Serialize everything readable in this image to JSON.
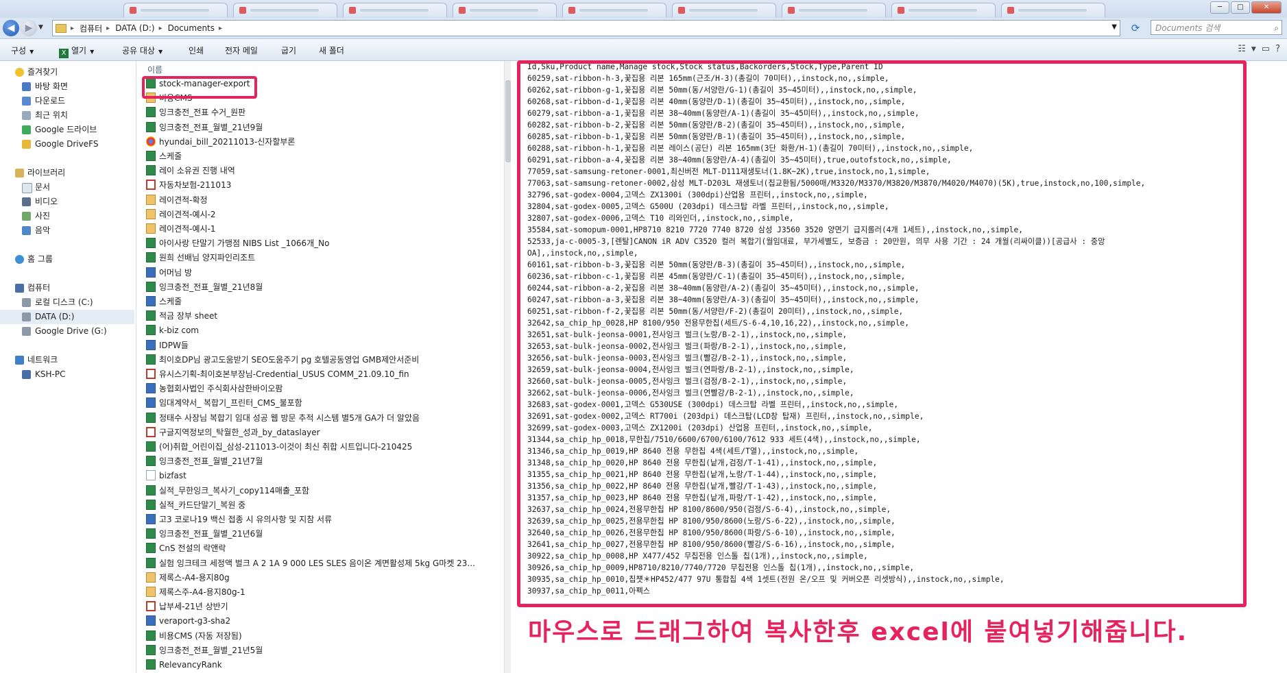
{
  "address": {
    "crumbs": [
      "컴퓨터",
      "DATA (D:)",
      "Documents"
    ],
    "search_placeholder": "Documents 검색"
  },
  "toolbar": {
    "organize": "구성",
    "open": "열기",
    "share": "공유 대상",
    "print": "인쇄",
    "email": "전자 메일",
    "burn": "굽기",
    "new_folder": "새 폴더"
  },
  "nav": {
    "favorites": "즐겨찾기",
    "desktop": "바탕 화면",
    "downloads": "다운로드",
    "recent": "최근 위치",
    "gdrive": "Google 드라이브",
    "gdrivefs": "Google DriveFS",
    "libraries": "라이브러리",
    "documents": "문서",
    "videos": "비디오",
    "pictures": "사진",
    "music": "음악",
    "homegroup": "홈 그룹",
    "computer": "컴퓨터",
    "local_c": "로컬 디스크 (C:)",
    "data_d": "DATA (D:)",
    "gdrive_g": "Google Drive (G:)",
    "network": "네트워크",
    "pc": "KSH-PC"
  },
  "file_list": {
    "column_name": "이름",
    "files": [
      {
        "name": "stock-manager-export",
        "icon": "excel-icon"
      },
      {
        "name": "비용CMS",
        "icon": "zip-icon"
      },
      {
        "name": "잉크충전_전표 수거_원판",
        "icon": "excel-icon"
      },
      {
        "name": "잉크충전_전표_월별_21년9월",
        "icon": "excel-icon"
      },
      {
        "name": "hyundai_bill_20211013-신자할부론",
        "icon": "chrome-icon"
      },
      {
        "name": "스케줄",
        "icon": "excel-icon"
      },
      {
        "name": "레이 소유권 진행 내역",
        "icon": "excel-icon"
      },
      {
        "name": "자동차보험-211013",
        "icon": "pdf-icon"
      },
      {
        "name": "레이견적-확정",
        "icon": "zip-icon"
      },
      {
        "name": "레이견적-예시-2",
        "icon": "zip-icon"
      },
      {
        "name": "레이견적-예시-1",
        "icon": "zip-icon"
      },
      {
        "name": "아이사랑 단말기 가맹점 NIBS List _1066개_No",
        "icon": "excel-icon"
      },
      {
        "name": "원희 선배님 양지파인리조트",
        "icon": "excel-icon"
      },
      {
        "name": "어머님 방",
        "icon": "hwp-icon"
      },
      {
        "name": "잉크충전_전표_월별_21년8월",
        "icon": "excel-icon"
      },
      {
        "name": "스케줄",
        "icon": "hwp-icon"
      },
      {
        "name": "적금 장부 sheet",
        "icon": "excel-icon"
      },
      {
        "name": "k-biz com",
        "icon": "excel-icon"
      },
      {
        "name": "IDPW들",
        "icon": "hwp-icon"
      },
      {
        "name": "최이호DP님 광고도움받기 SEO도움주기 pg 호텔공동영업 GMB제안서준비",
        "icon": "excel-icon"
      },
      {
        "name": "유시스기획-최이호본부장님-Credential_USUS COMM_21.09.10_fin",
        "icon": "pdf-icon"
      },
      {
        "name": "농협회사법인 주식회사삼한바이오팜",
        "icon": "hwp-icon"
      },
      {
        "name": "임대계약서_ 복합기_프린터_CMS_불포함",
        "icon": "hwp-icon"
      },
      {
        "name": "정태수 사장님    복합기 임대 성공    웹 방문 추적 시스템 별5개     GA가 더 알았음",
        "icon": "excel-icon"
      },
      {
        "name": "구글지역정보의_탁월한_성과_by_dataslayer",
        "icon": "pdf-icon"
      },
      {
        "name": "(어)취합_어린이집_삼성-211013-이것이 최신 취합 시트입니다-210425",
        "icon": "excel-icon"
      },
      {
        "name": "잉크충전_전표_월별_21년7월",
        "icon": "excel-icon"
      },
      {
        "name": "bizfast",
        "icon": "text-icon"
      },
      {
        "name": "실적_무한잉크_복사기_copy114매출_포함",
        "icon": "excel-icon"
      },
      {
        "name": "실적_카드단말기_복원 중",
        "icon": "excel-icon"
      },
      {
        "name": "고3 코로나19 백신 접종 시 유의사항 및 지참 서류",
        "icon": "hwp-icon"
      },
      {
        "name": "잉크충전_전표_월별_21년6월",
        "icon": "excel-icon"
      },
      {
        "name": "CnS 전설의 락앤락",
        "icon": "excel-icon"
      },
      {
        "name": "실험 잉크테크 세정액 벌크 A 2 1A    9 000     LES SLES  음이온 계면활성제   5kg G마켓 23...",
        "icon": "excel-icon"
      },
      {
        "name": "제록스-A4-용지80g",
        "icon": "zip-icon"
      },
      {
        "name": "제록스주-A4-용지80g-1",
        "icon": "zip-icon"
      },
      {
        "name": "납부세-21년 상반기",
        "icon": "pdf-icon"
      },
      {
        "name": "veraport-g3-sha2",
        "icon": "hwp-icon"
      },
      {
        "name": "비용CMS (자동 저장됨)",
        "icon": "excel-icon"
      },
      {
        "name": "잉크충전_전표_월별_21년5월",
        "icon": "excel-icon"
      },
      {
        "name": "RelevancyRank",
        "icon": "excel-icon"
      }
    ]
  },
  "preview": {
    "lines": [
      "Id,Sku,Product name,Manage stock,Stock status,Backorders,Stock,Type,Parent ID",
      "60259,sat-ribbon-h-3,꽃집용 리본 165mm(근조/H-3)(총길이 70미터),,instock,no,,simple,",
      "60262,sat-ribbon-g-1,꽃집용 리본 50mm(동/서양란/G-1)(총길이 35~45미터),,instock,no,,simple,",
      "60268,sat-ribbon-d-1,꽃집용 리본 40mm(동양란/D-1)(총길이 35~45미터),,instock,no,,simple,",
      "60279,sat-ribbon-a-1,꽃집용 리본 38~40mm(동양란/A-1)(총길이 35~45미터),,instock,no,,simple,",
      "60282,sat-ribbon-b-2,꽃집용 리본 50mm(동양란/B-2)(총길이 35~45미터),,instock,no,,simple,",
      "60285,sat-ribbon-b-1,꽃집용 리본 50mm(동양란/B-1)(총길이 35~45미터),,instock,no,,simple,",
      "60288,sat-ribbon-h-1,꽃집용 리본 레이스(공단) 리본 165mm(3단 화환/H-1)(총길이 70미터),,instock,no,,simple,",
      "60291,sat-ribbon-a-4,꽃집용 리본 38~40mm(동양란/A-4)(총길이 35~45미터),true,outofstock,no,,simple,",
      "77059,sat-samsung-retoner-0001,최신버전 MLT-D111재생토너(1.8K~2K),true,instock,no,1,simple,",
      "77063,sat-samsung-retoner-0002,삼성 MLT-D203L 재생토너(칩교환됨/5000매/M3320/M3370/M3820/M3870/M4020/M4070)(5K),true,instock,no,100,simple,",
      "32796,sat-godex-0004,고덱스 ZX1300i (300dpi)산업용 프린터,,instock,no,,simple,",
      "32804,sat-godex-0005,고덱스 G500U (203dpi) 데스크탑 라벨 프린터,,instock,no,,simple,",
      "32807,sat-godex-0006,고덱스 T10 리와인더,,instock,no,,simple,",
      "35584,sat-somopum-0001,HP8710 8210 7720 7740 8720 삼성 J3560 3520 양면기 급지롤러(4개 1세트),,instock,no,,simple,",
      "52533,ja-c-0005-3,[렌탈]CANON iR ADV C3520 컬러 복합기(월임대료, 부가세별도, 보증금 : 20만원, 의무 사용 기간 : 24 개월(리싸이클))[공급사 : 중앙",
      "OA],,instock,no,,simple,",
      "60161,sat-ribbon-b-3,꽃집용 리본 50mm(동양란/B-3)(총길이 35~45미터),,instock,no,,simple,",
      "60236,sat-ribbon-c-1,꽃집용 리본 45mm(동양란/C-1)(총길이 35~45미터),,instock,no,,simple,",
      "60244,sat-ribbon-a-2,꽃집용 리본 38~40mm(동양란/A-2)(총길이 35~45미터),,instock,no,,simple,",
      "60247,sat-ribbon-a-3,꽃집용 리본 38~40mm(동양란/A-3)(총길이 35~45미터),,instock,no,,simple,",
      "60251,sat-ribbon-f-2,꽃집용 리본 50mm(동/서양란/F-2)(총길이 20미터),,instock,no,,simple,",
      "32642,sa_chip_hp_0028,HP 8100/950 전용무한칩(세트/S-6-4,10,16,22),,instock,no,,simple,",
      "32651,sat-bulk-jeonsa-0001,전사잉크 벌크(노랑/B-2-1),,instock,no,,simple,",
      "32653,sat-bulk-jeonsa-0002,전사잉크 벌크(파랑/B-2-1),,instock,no,,simple,",
      "32656,sat-bulk-jeonsa-0003,전사잉크 벌크(빨강/B-2-1),,instock,no,,simple,",
      "32659,sat-bulk-jeonsa-0004,전사잉크 벌크(연파랑/B-2-1),,instock,no,,simple,",
      "32660,sat-bulk-jeonsa-0005,전사잉크 벌크(검정/B-2-1),,instock,no,,simple,",
      "32662,sat-bulk-jeonsa-0006,전사잉크 벌크(연빨강/B-2-1),,instock,no,,simple,",
      "32683,sat-godex-0001,고덱스 G530USE (300dpi) 데스크탑 라벨 프린터,,instock,no,,simple,",
      "32691,sat-godex-0002,고덱스 RT700i (203dpi) 데스크탑(LCD창 탑재) 프린터,,instock,no,,simple,",
      "32699,sat-godex-0003,고덱스 ZX1200i (203dpi) 산업용 프린터,,instock,no,,simple,",
      "31344,sa_chip_hp_0018,무한칩/7510/6600/6700/6100/7612 933 세트(4색),,instock,no,,simple,",
      "31346,sa_chip_hp_0019,HP 8640 전용 무한칩 4색(세트/T열),,instock,no,,simple,",
      "31348,sa_chip_hp_0020,HP 8640 전용 무한칩(낱개,검정/T-1-41),,instock,no,,simple,",
      "31355,sa_chip_hp_0021,HP 8640 전용 무한칩(낱개,노랑/T-1-44),,instock,no,,simple,",
      "31356,sa_chip_hp_0022,HP 8640 전용 무한칩(낱개,빨강/T-1-43),,instock,no,,simple,",
      "31357,sa_chip_hp_0023,HP 8640 전용 무한칩(낱개,파랑/T-1-42),,instock,no,,simple,",
      "32637,sa_chip_hp_0024,전용무한칩 HP 8100/8600/950(검정/S-6-4),,instock,no,,simple,",
      "32639,sa_chip_hp_0025,전용무한칩 HP 8100/950/8600(노랑/S-6-22),,instock,no,,simple,",
      "32640,sa_chip_hp_0026,전용무한칩 HP 8100/950/8600(파랑/S-6-10),,instock,no,,simple,",
      "32641,sa_chip_hp_0027,전용무한칩 HP 8100/950/8600(빨강/S-6-16),,instock,no,,simple,",
      "30922,sa_chip_hp_0008,HP X477/452 무칩전용 인스톨 칩(1개),,instock,no,,simple,",
      "30926,sa_chip_hp_0009,HP8710/8210/7740/7720 무칩전용 인스톨 칩(1개),,instock,no,,simple,",
      "30935,sa_chip_hp_0010,칩첏＊HP452/477 97U 통합칩 4색 1셋트(전원 온/오프 및 커버오픈 리셋방식),,instock,no,,simple,",
      "30937,sa_chip_hp_0011,아펙스"
    ]
  },
  "annotation": {
    "caption": "마우스로 드래그하여 복사한후 excel에 붙여넣기해줍니다."
  }
}
